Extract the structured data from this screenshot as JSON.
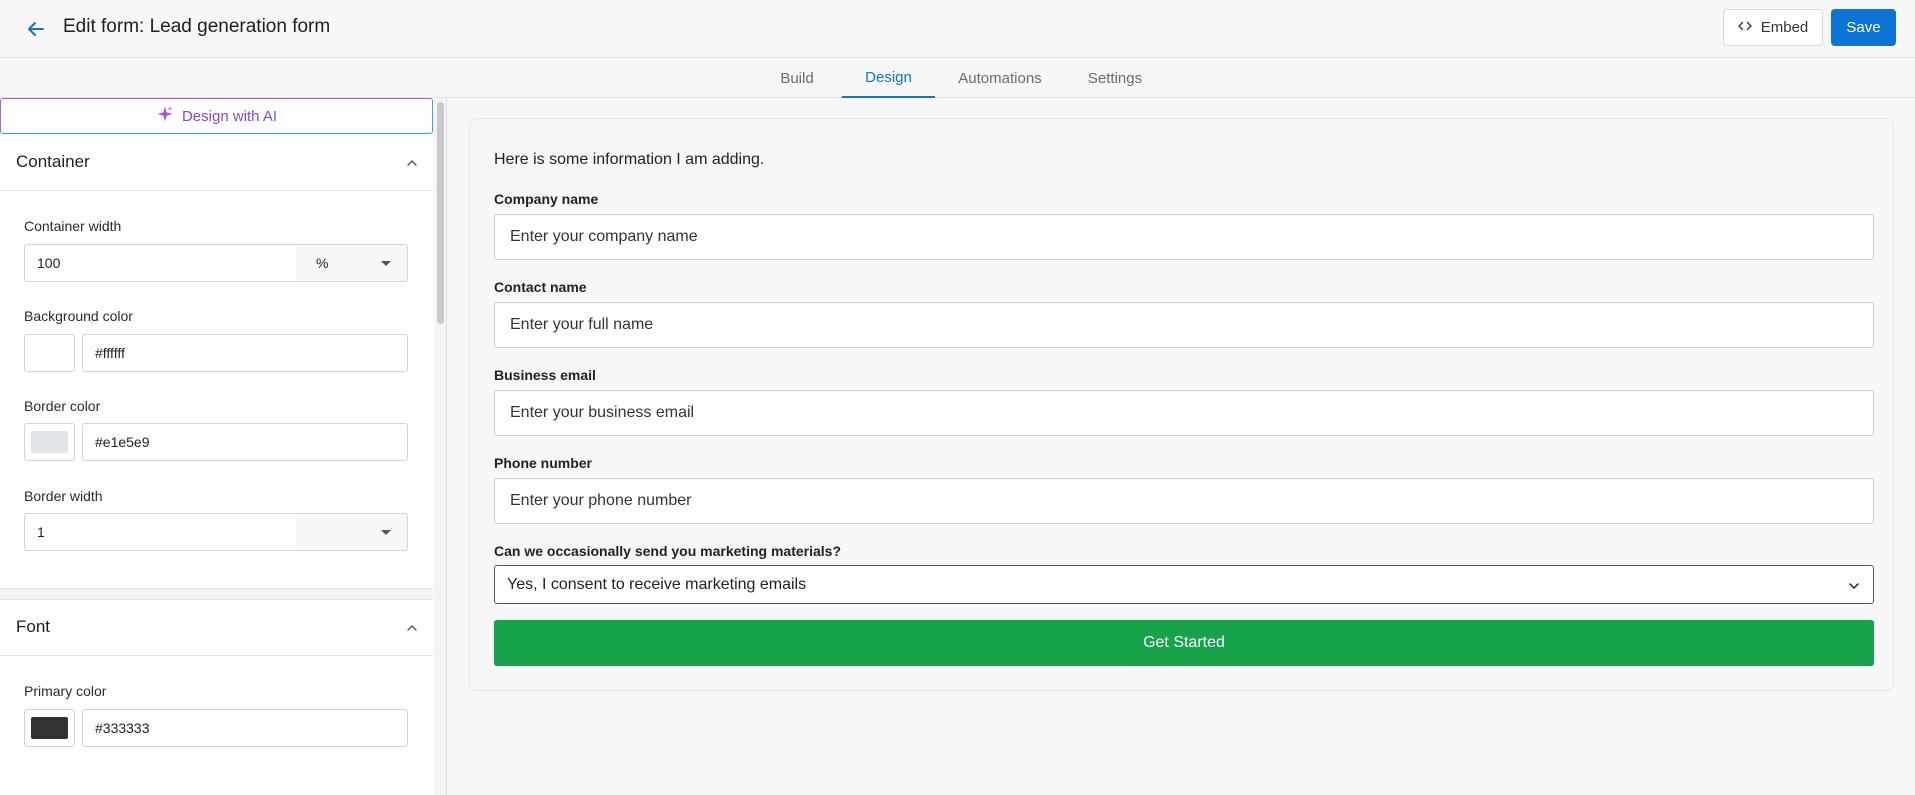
{
  "header": {
    "title": "Edit form: Lead generation form",
    "embed_label": "Embed",
    "save_label": "Save"
  },
  "tabs": [
    {
      "label": "Build"
    },
    {
      "label": "Design",
      "active": true
    },
    {
      "label": "Automations"
    },
    {
      "label": "Settings"
    }
  ],
  "sidebar": {
    "ai_button_label": "Design with AI",
    "container": {
      "title": "Container",
      "width_label": "Container width",
      "width_value": "100",
      "width_unit": "%",
      "bg_label": "Background color",
      "bg_value": "#ffffff",
      "border_color_label": "Border color",
      "border_color_value": "#e1e5e9",
      "border_width_label": "Border width",
      "border_width_value": "1",
      "border_width_unit": ""
    },
    "font": {
      "title": "Font",
      "primary_label": "Primary color",
      "primary_value": "#333333"
    }
  },
  "form": {
    "intro": "Here is some information I am adding.",
    "fields": [
      {
        "label": "Company name",
        "placeholder": "Enter your company name"
      },
      {
        "label": "Contact name",
        "placeholder": "Enter your full name"
      },
      {
        "label": "Business email",
        "placeholder": "Enter your business email"
      },
      {
        "label": "Phone number",
        "placeholder": "Enter your phone number"
      }
    ],
    "consent_label": "Can we occasionally send you marketing materials?",
    "consent_value": "Yes, I consent to receive marketing emails",
    "submit_label": "Get Started"
  },
  "colors": {
    "accent": "#0b74d4",
    "submit": "#16a34a",
    "ai_gradient": [
      "#b659e6",
      "#2aa8d6"
    ]
  },
  "icons": {
    "back": "arrow-left-icon",
    "embed": "code-icon",
    "ai": "sparkle-icon",
    "collapse": "chevron-up-icon",
    "dropdown": "chevron-down-icon"
  }
}
